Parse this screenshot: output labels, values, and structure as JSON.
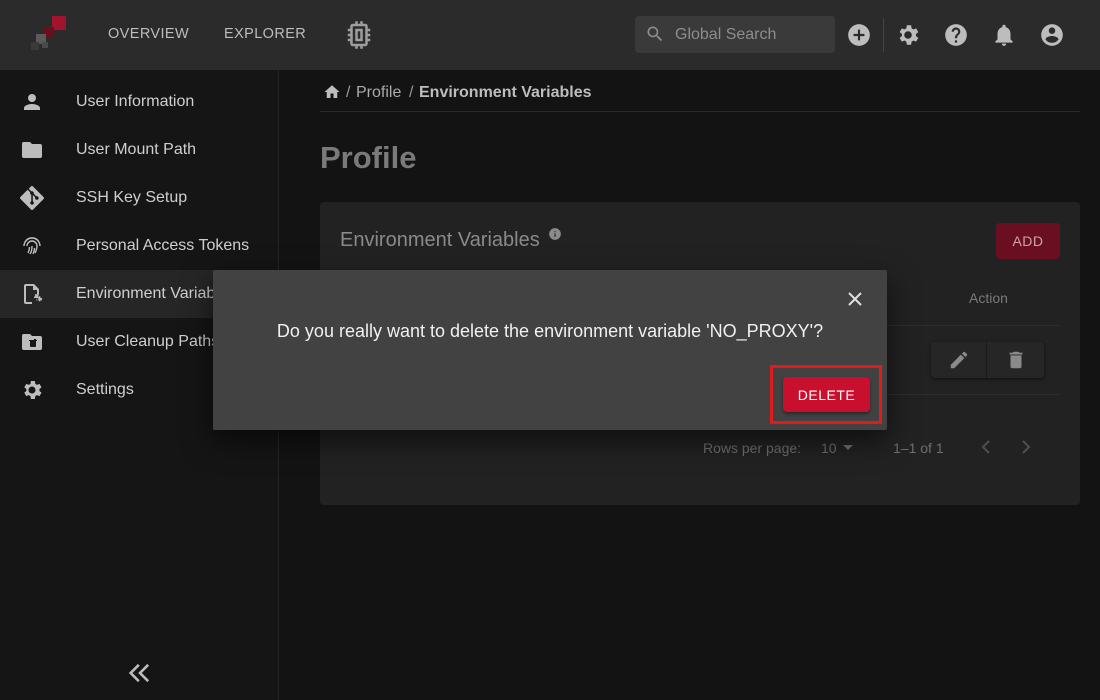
{
  "topbar": {
    "nav": [
      "OVERVIEW",
      "EXPLORER"
    ],
    "search_placeholder": "Global Search",
    "icons": [
      "chip-icon",
      "search-icon",
      "add-circle-icon",
      "gear-icon",
      "help-icon",
      "bell-icon",
      "account-icon"
    ]
  },
  "sidebar": {
    "items": [
      {
        "label": "User Information",
        "icon": "person-icon"
      },
      {
        "label": "User Mount Path",
        "icon": "folder-icon"
      },
      {
        "label": "SSH Key Setup",
        "icon": "git-icon"
      },
      {
        "label": "Personal Access Tokens",
        "icon": "fingerprint-icon"
      },
      {
        "label": "Environment Variables",
        "icon": "file-gear-icon",
        "active": true
      },
      {
        "label": "User Cleanup Paths",
        "icon": "folder-delete-icon"
      },
      {
        "label": "Settings",
        "icon": "gear-icon"
      }
    ]
  },
  "breadcrumb": {
    "sep": "/",
    "items": [
      "Profile",
      "Environment Variables"
    ]
  },
  "page": {
    "title": "Profile"
  },
  "card": {
    "title": "Environment Variables",
    "add_label": "ADD",
    "action_header": "Action",
    "rows_per_page_label": "Rows per page:",
    "rows_per_page_value": "10",
    "range": "1–1 of 1"
  },
  "dialog": {
    "message": "Do you really want to delete the environment variable 'NO_PROXY'?",
    "delete_label": "DELETE"
  },
  "colors": {
    "accent": "#c8102e",
    "highlight": "#e01b1b"
  }
}
